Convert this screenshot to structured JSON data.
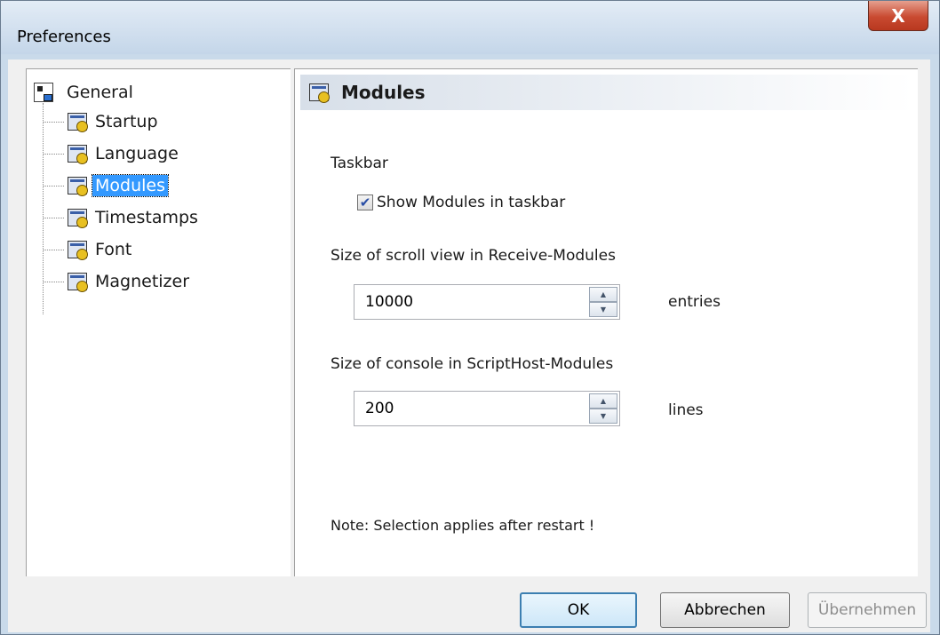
{
  "window": {
    "title": "Preferences",
    "close_glyph": "X"
  },
  "tree": {
    "root_label": "General",
    "items": [
      {
        "label": "Startup"
      },
      {
        "label": "Language"
      },
      {
        "label": "Modules",
        "selected": true
      },
      {
        "label": "Timestamps"
      },
      {
        "label": "Font"
      },
      {
        "label": "Magnetizer"
      }
    ]
  },
  "panel": {
    "header": "Modules",
    "taskbar_label": "Taskbar",
    "show_in_taskbar_label": "Show Modules in taskbar",
    "show_in_taskbar_checked": true,
    "scroll_label": "Size of scroll view in Receive-Modules",
    "scroll_value": "10000",
    "scroll_unit": "entries",
    "console_label": "Size of console in ScriptHost-Modules",
    "console_value": "200",
    "console_unit": "lines",
    "note": "Note: Selection applies after restart !"
  },
  "buttons": {
    "ok": "OK",
    "cancel": "Abbrechen",
    "apply": "Übernehmen"
  },
  "icons": {
    "tree_root": "tree-icon",
    "module": "module-icon",
    "spin_up": "spin-up-icon",
    "spin_down": "spin-down-icon"
  },
  "colors": {
    "selection": "#3399ff",
    "close_button": "#c94a31",
    "title_bar": "#c4d6e9"
  }
}
